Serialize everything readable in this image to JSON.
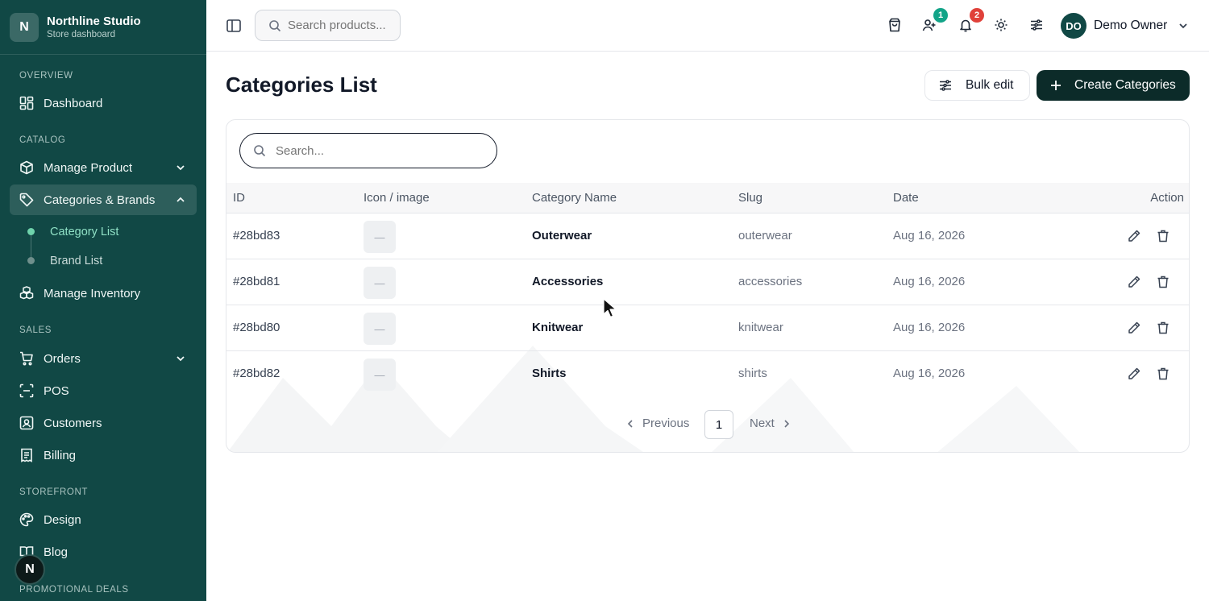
{
  "brand": {
    "logo_letter": "N",
    "name": "Northline Studio",
    "subtitle": "Store dashboard"
  },
  "sidebar": {
    "sections": [
      {
        "label": "OVERVIEW"
      },
      {
        "label": "CATALOG"
      },
      {
        "label": "SALES"
      },
      {
        "label": "STOREFRONT"
      },
      {
        "label": "PROMOTIONAL DEALS"
      }
    ],
    "items": [
      {
        "label": "Dashboard",
        "icon": "dashboard-icon"
      },
      {
        "label": "Manage Product",
        "icon": "box-icon"
      },
      {
        "label": "Categories & Brands",
        "icon": "tag-icon"
      },
      {
        "label": "Manage Inventory",
        "icon": "inventory-icon"
      },
      {
        "label": "Orders",
        "icon": "cart-icon"
      },
      {
        "label": "POS",
        "icon": "pos-icon"
      },
      {
        "label": "Customers",
        "icon": "customers-icon"
      },
      {
        "label": "Billing",
        "icon": "billing-icon"
      },
      {
        "label": "Design",
        "icon": "palette-icon"
      },
      {
        "label": "Blog",
        "icon": "book-icon"
      }
    ],
    "sub_items": [
      {
        "label": "Category List",
        "active": true
      },
      {
        "label": "Brand List",
        "active": false
      }
    ],
    "fab_letter": "N"
  },
  "topbar": {
    "search_placeholder": "Search products...",
    "customers_badge": "1",
    "notifications_badge": "2",
    "user_initials": "DO",
    "user_name": "Demo Owner"
  },
  "page": {
    "title": "Categories List",
    "bulk_edit_label": "Bulk edit",
    "create_label": "Create Categories",
    "search_placeholder": "Search..."
  },
  "table": {
    "columns": [
      "ID",
      "Icon / image",
      "Category Name",
      "Slug",
      "Date",
      "Action"
    ],
    "rows": [
      {
        "id": "#28bd83",
        "image": "—",
        "name": "Outerwear",
        "slug": "outerwear",
        "date": "Aug 16, 2026"
      },
      {
        "id": "#28bd81",
        "image": "—",
        "name": "Accessories",
        "slug": "accessories",
        "date": "Aug 16, 2026"
      },
      {
        "id": "#28bd80",
        "image": "—",
        "name": "Knitwear",
        "slug": "knitwear",
        "date": "Aug 16, 2026"
      },
      {
        "id": "#28bd82",
        "image": "—",
        "name": "Shirts",
        "slug": "shirts",
        "date": "Aug 16, 2026"
      }
    ]
  },
  "pagination": {
    "previous_label": "Previous",
    "current_page": "1",
    "next_label": "Next"
  },
  "colors": {
    "sidebar_bg": "#114845",
    "primary_button": "#0c2b29",
    "active_sub": "#8fe0c5",
    "badge_green": "#12a488",
    "badge_red": "#e0413a"
  }
}
